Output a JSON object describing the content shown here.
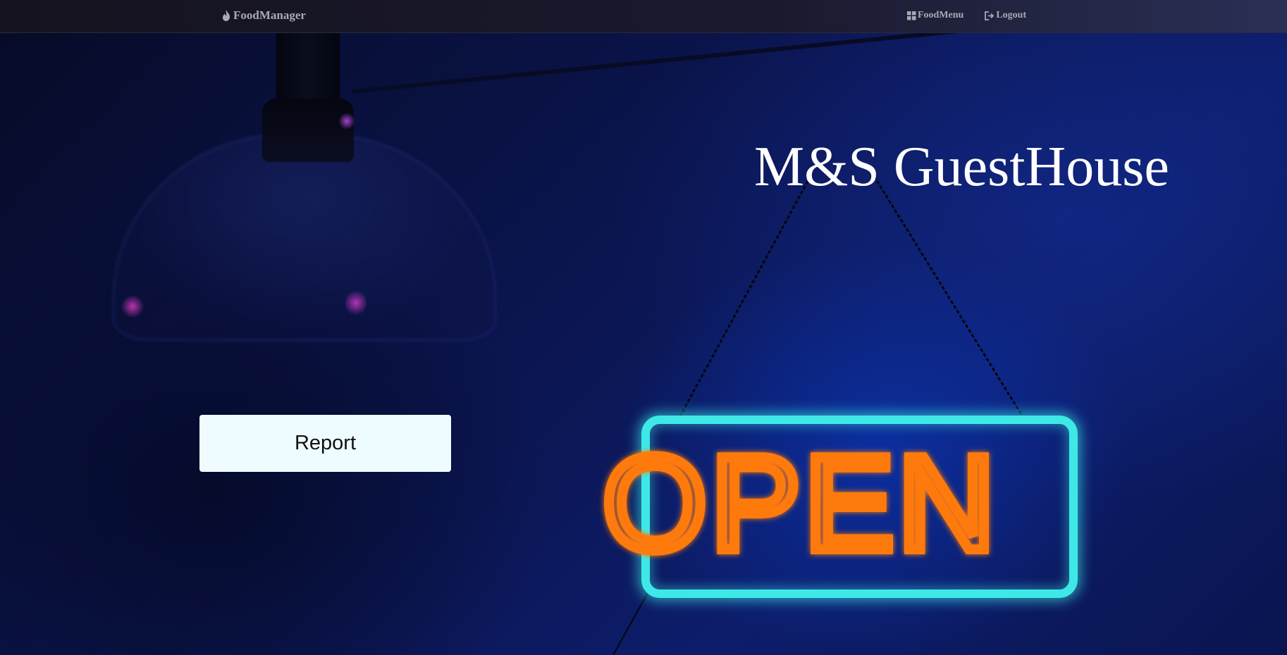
{
  "navbar": {
    "brand": "FoodManager",
    "brand_icon": "flame-icon",
    "links": [
      {
        "label": "FoodMenu",
        "icon": "grid-icon"
      },
      {
        "label": "Logout",
        "icon": "logout-icon"
      }
    ]
  },
  "hero": {
    "title": "M&S GuestHouse",
    "report_button": "Report",
    "sign_text": "OPEN"
  },
  "colors": {
    "navbar_bg": "#15131f",
    "nav_text": "#a9a9b4",
    "button_bg": "#effcff",
    "neon_frame": "#3ee8e6",
    "neon_letters": "#ff6a00"
  }
}
